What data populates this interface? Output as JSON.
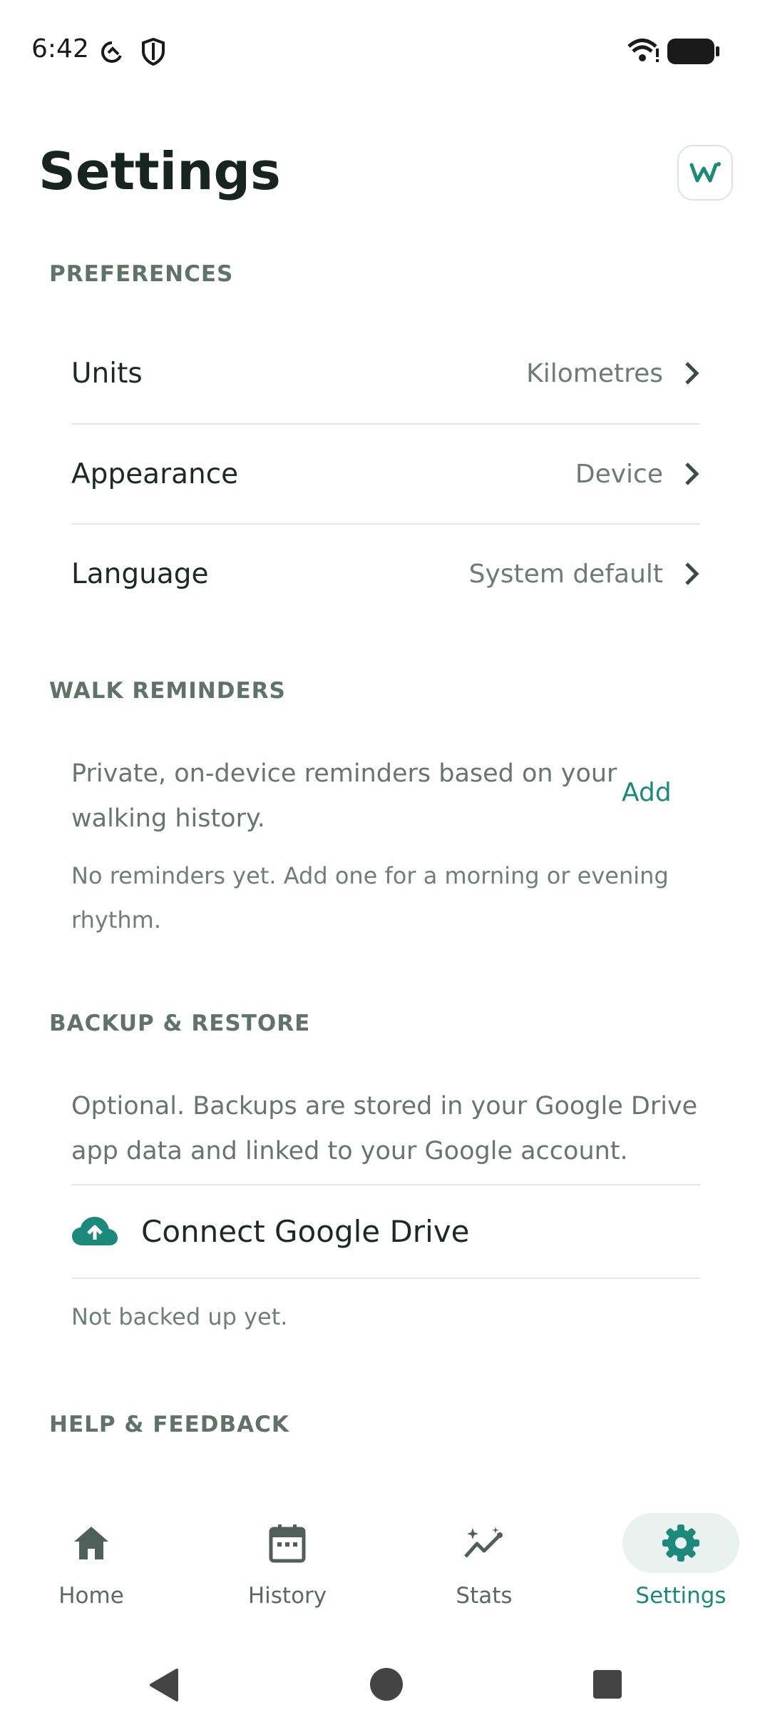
{
  "status_bar": {
    "time": "6:42"
  },
  "header": {
    "title": "Settings"
  },
  "preferences": {
    "header": "PREFERENCES",
    "items": [
      {
        "label": "Units",
        "value": "Kilometres"
      },
      {
        "label": "Appearance",
        "value": "Device"
      },
      {
        "label": "Language",
        "value": "System default"
      }
    ]
  },
  "walk_reminders": {
    "header": "WALK REMINDERS",
    "description_line1": "Private, on-device reminders based on your",
    "description_line2": "walking history.",
    "add_label": "Add",
    "empty_line1": "No reminders yet. Add one for a morning or evening",
    "empty_line2": "rhythm."
  },
  "backup": {
    "header": "BACKUP & RESTORE",
    "description_line1": "Optional. Backups are stored in your Google Drive",
    "description_line2": "app data and linked to your Google account.",
    "connect_label": "Connect Google Drive",
    "status": "Not backed up yet."
  },
  "help": {
    "header": "HELP & FEEDBACK"
  },
  "bottom_nav": {
    "items": [
      {
        "label": "Home",
        "icon": "home-icon"
      },
      {
        "label": "History",
        "icon": "calendar-icon"
      },
      {
        "label": "Stats",
        "icon": "stats-icon"
      },
      {
        "label": "Settings",
        "icon": "gear-icon",
        "active": true
      }
    ]
  },
  "colors": {
    "accent": "#1b8a7a",
    "text": "#1c2a25",
    "muted": "#5f736b"
  }
}
